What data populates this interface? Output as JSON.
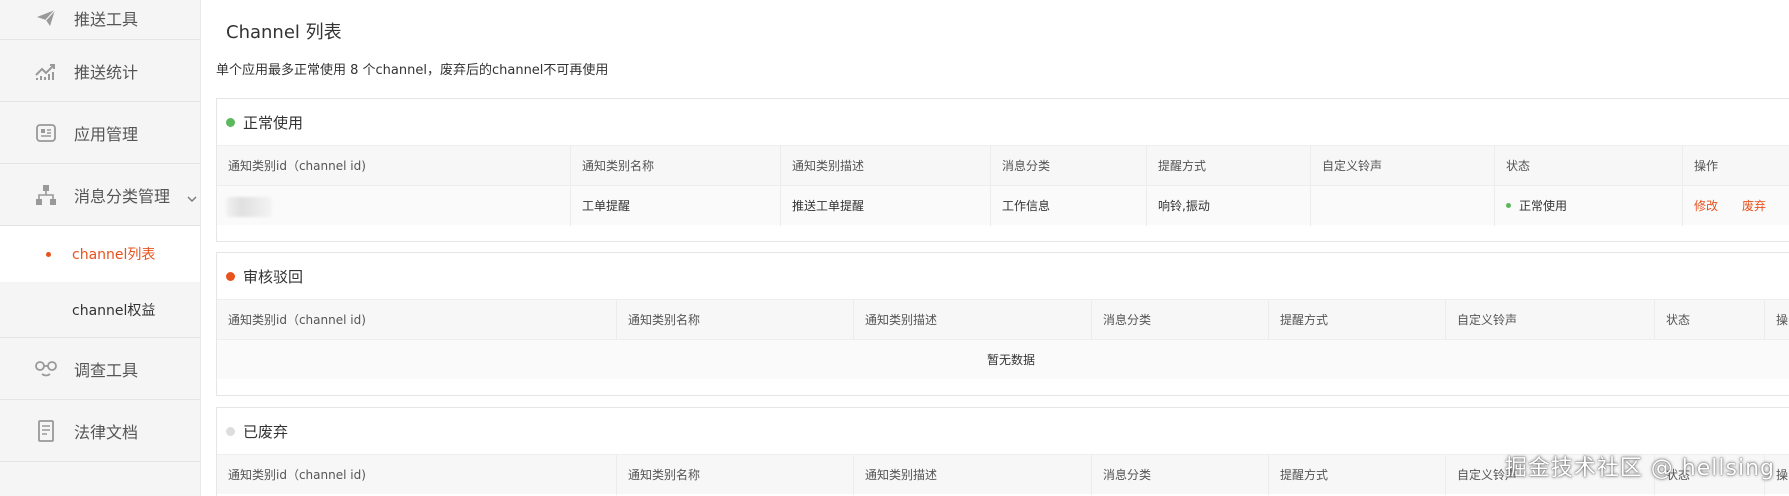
{
  "sidebar": {
    "items_top": [
      {
        "label": "推送工具",
        "icon": "send-icon"
      },
      {
        "label": "推送统计",
        "icon": "trend-chart-icon"
      },
      {
        "label": "应用管理",
        "icon": "app-card-icon"
      },
      {
        "label": "消息分类管理",
        "icon": "org-tree-icon"
      }
    ],
    "sub_items": [
      {
        "label": "channel列表",
        "active": true
      },
      {
        "label": "channel权益",
        "active": false
      }
    ],
    "items_bottom": [
      {
        "label": "调查工具",
        "icon": "survey-glasses-icon"
      },
      {
        "label": "法律文档",
        "icon": "document-icon"
      }
    ]
  },
  "main": {
    "title": "Channel 列表",
    "description": "单个应用最多正常使用 8 个channel，废弃后的channel不可再使用",
    "sections": [
      {
        "title": "正常使用",
        "dot_color": "#5cb85c",
        "columns": [
          "通知类别id（channel id)",
          "通知类别名称",
          "通知类别描述",
          "消息分类",
          "提醒方式",
          "自定义铃声",
          "状态",
          "操作"
        ],
        "rows": [
          {
            "id": "",
            "name": "工单提醒",
            "desc": "推送工单提醒",
            "category": "工作信息",
            "remind": "响铃,振动",
            "ringtone": "",
            "status": "正常使用",
            "ops": [
              "修改",
              "废弃"
            ]
          }
        ]
      },
      {
        "title": "审核驳回",
        "dot_color": "#e8521d",
        "columns": [
          "通知类别id（channel id)",
          "通知类别名称",
          "通知类别描述",
          "消息分类",
          "提醒方式",
          "自定义铃声",
          "状态",
          "操"
        ],
        "empty_text": "暂无数据"
      },
      {
        "title": "已废弃",
        "dot_color": "#dddddd",
        "columns": [
          "通知类别id（channel id)",
          "通知类别名称",
          "通知类别描述",
          "消息分类",
          "提醒方式",
          "自定义铃声",
          "状态",
          "操"
        ]
      }
    ]
  },
  "watermark": "掘金技术社区 @ hellsing",
  "colors": {
    "accent": "#e8521d",
    "ok": "#5cb85c",
    "sidebar_bg": "#f5f5f5"
  }
}
